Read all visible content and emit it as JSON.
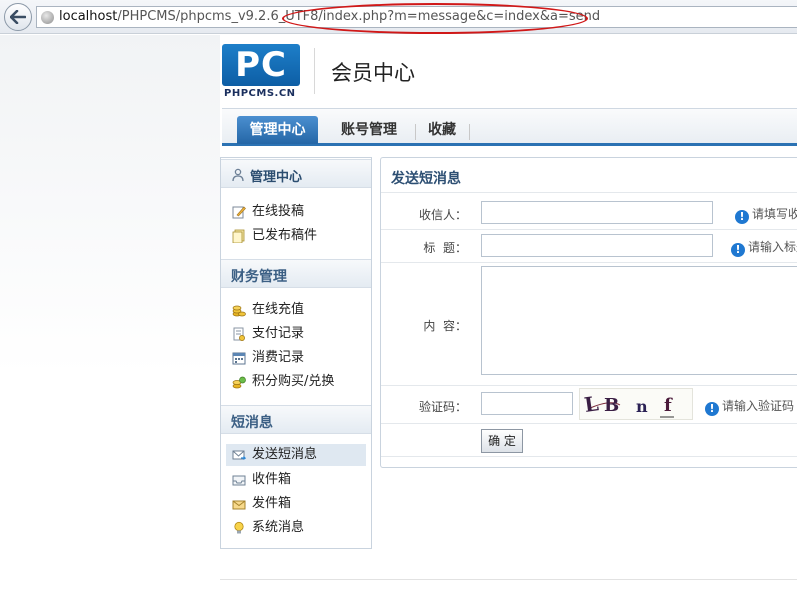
{
  "browser": {
    "url_host": "localhost",
    "url_path": "/PHPCMS/phpcms_v9.2.6_UTF8/index.php?m=message&c=index&a=send"
  },
  "header": {
    "logo_text": "PC",
    "logo_caption": "PHPCMS.CN",
    "site_title": "会员中心"
  },
  "nav": {
    "tabs": [
      {
        "label": "管理中心",
        "active": true
      },
      {
        "label": "账号管理",
        "active": false
      },
      {
        "label": "收藏",
        "active": false
      }
    ]
  },
  "sidebar": {
    "sections": [
      {
        "title": "管理中心",
        "items": [
          {
            "label": "在线投稿",
            "icon": "edit-icon"
          },
          {
            "label": "已发布稿件",
            "icon": "documents-icon"
          }
        ]
      },
      {
        "title": "财务管理",
        "items": [
          {
            "label": "在线充值",
            "icon": "coins-icon"
          },
          {
            "label": "支付记录",
            "icon": "receipt-icon"
          },
          {
            "label": "消费记录",
            "icon": "calendar-icon"
          },
          {
            "label": "积分购买/兑换",
            "icon": "coins-exchange-icon"
          }
        ]
      },
      {
        "title": "短消息",
        "items": [
          {
            "label": "发送短消息",
            "icon": "mail-send-icon",
            "current": true
          },
          {
            "label": "收件箱",
            "icon": "inbox-icon"
          },
          {
            "label": "发件箱",
            "icon": "outbox-icon"
          },
          {
            "label": "系统消息",
            "icon": "lightbulb-icon"
          }
        ]
      }
    ]
  },
  "form": {
    "title": "发送短消息",
    "recipient_label": "收信人：",
    "recipient_value": "",
    "recipient_hint": "请填写收信人",
    "subject_label": "标  题：",
    "subject_value": "",
    "subject_hint": "请输入标题",
    "content_label": "内  容：",
    "content_value": "",
    "captcha_label": "验证码：",
    "captcha_value": "",
    "captcha_image_text": "LBnf",
    "captcha_hint": "请输入验证码",
    "submit_label": "确 定"
  },
  "colors": {
    "accent": "#2b72b3",
    "logo_blue": "#1e7fc9",
    "highlight_ellipse": "#d01818"
  }
}
